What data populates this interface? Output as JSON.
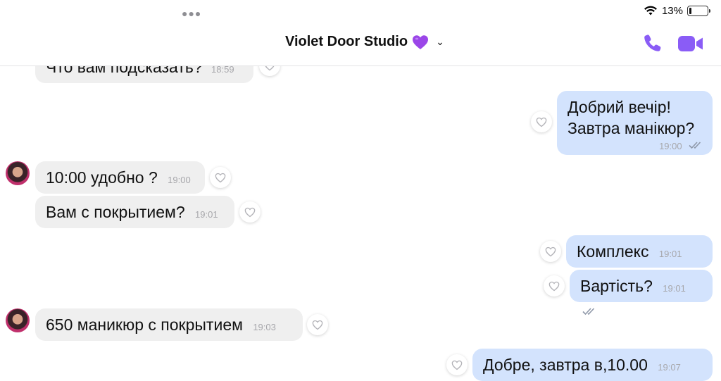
{
  "status_bar": {
    "battery": "13%",
    "battery_level": 0.13
  },
  "header": {
    "title": "Violet Door Studio",
    "title_emoji": "purple-heart",
    "accent": "#8a5cf6"
  },
  "messages": [
    {
      "from": "them",
      "text": "Что вам подсказать?",
      "time": "18:59"
    },
    {
      "from": "me",
      "line1": "Добрий вечір!",
      "line2": "Завтра манікюр?",
      "time": "19:00"
    },
    {
      "from": "them",
      "text": "10:00 удобно ?",
      "time": "19:00"
    },
    {
      "from": "them",
      "text": "Вам с покрытием?",
      "time": "19:01"
    },
    {
      "from": "me",
      "text": "Комплекс",
      "time": "19:01"
    },
    {
      "from": "me",
      "text": "Вартість?",
      "time": "19:01"
    },
    {
      "from": "them",
      "text": "650 маникюр с покрытием",
      "time": "19:03"
    },
    {
      "from": "me",
      "text": "Добре, завтра в,10.00",
      "time": "19:07"
    }
  ],
  "colors": {
    "incoming_bubble": "#efefef",
    "outgoing_bubble": "#d3e3fd",
    "read_checks": "#8e97a8"
  }
}
